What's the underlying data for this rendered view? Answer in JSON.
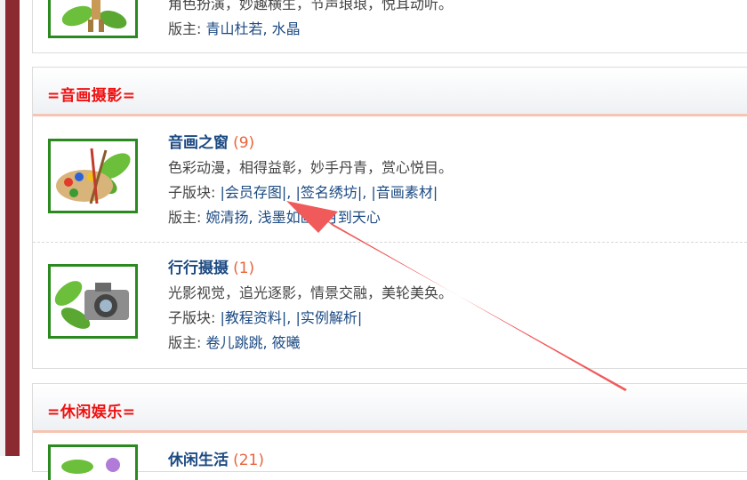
{
  "top_partial": {
    "desc": "角色扮演，妙趣横生，节声琅琅，悦耳动听。",
    "mod_label": "版主: ",
    "mods": [
      "青山杜若",
      "水晶"
    ]
  },
  "sections": [
    {
      "title": "=音画摄影=",
      "forums": [
        {
          "name": "音画之窗",
          "count": "(9)",
          "desc": "色彩动漫，相得益彰，妙手丹青，赏心悦目。",
          "sub_label": "子版块: ",
          "subs": [
            "|会员存图|",
            "|签名绣坊|",
            "|音画素材|"
          ],
          "mod_label": "版主: ",
          "mods": [
            "婉清扬",
            "浅墨如画",
            "月到天心"
          ]
        },
        {
          "name": "行行摄摄",
          "count": "(1)",
          "desc": "光影视觉，追光逐影，情景交融，美轮美奂。",
          "sub_label": "子版块: ",
          "subs": [
            "|教程资料|",
            "|实例解析|"
          ],
          "mod_label": "版主: ",
          "mods": [
            "卷儿跳跳",
            "筱曦"
          ]
        }
      ]
    },
    {
      "title": "=休闲娱乐=",
      "forums": [
        {
          "name": "休闲生活",
          "count": "(21)"
        }
      ]
    }
  ],
  "annotation": {
    "color": "#f05a5a"
  }
}
